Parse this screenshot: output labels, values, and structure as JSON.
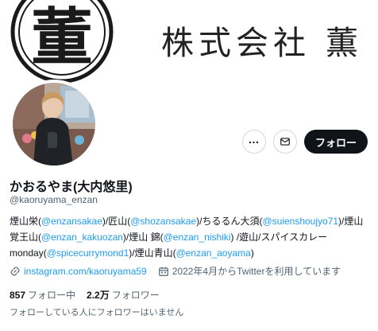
{
  "banner": {
    "company_text": "株式会社 薫",
    "logo_glyph": "董"
  },
  "profile": {
    "display_name": "かおるやま(大内悠里)",
    "handle": "@kaoruyama_enzan"
  },
  "actions": {
    "more_icon": "more-dots-icon",
    "message_icon": "envelope-icon",
    "follow_label": "フォロー"
  },
  "bio": {
    "segments": [
      {
        "text": "煙山栄(",
        "link": false
      },
      {
        "text": "@enzansakae",
        "link": true
      },
      {
        "text": ")/匠山(",
        "link": false
      },
      {
        "text": "@shozansakae",
        "link": true
      },
      {
        "text": ")/ちるるん大須(",
        "link": false
      },
      {
        "text": "@suienshoujyo71",
        "link": true
      },
      {
        "text": ")/煙山覚王山(",
        "link": false
      },
      {
        "text": "@enzan_kakuozan",
        "link": true
      },
      {
        "text": ")/煙山 錦(",
        "link": false
      },
      {
        "text": "@enzan_nishiki",
        "link": true
      },
      {
        "text": ") /遊山/スパイスカレーmonday(",
        "link": false
      },
      {
        "text": "@spicecurrymond1",
        "link": true
      },
      {
        "text": ")/煙山青山(",
        "link": false
      },
      {
        "text": "@enzan_aoyama",
        "link": true
      },
      {
        "text": ")",
        "link": false
      }
    ]
  },
  "meta": {
    "website": "instagram.com/kaoruyama59",
    "joined": "2022年4月からTwitterを利用しています"
  },
  "stats": {
    "following_count": "857",
    "following_label": "フォロー中",
    "followers_count": "2.2万",
    "followers_label": "フォロワー"
  },
  "followed_by": "フォローしている人にフォロワーはいません",
  "colors": {
    "link": "#1d9bf0",
    "text": "#0f1419",
    "muted": "#536471",
    "button_dark": "#0f1419"
  }
}
